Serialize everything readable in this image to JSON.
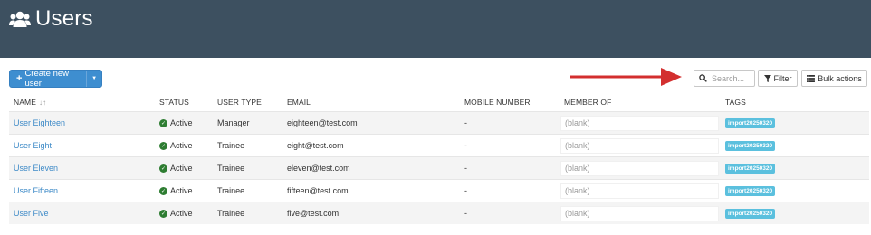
{
  "header": {
    "title": "Users",
    "icon": "users-icon"
  },
  "toolbar": {
    "create_label": "Create new user",
    "search_placeholder": "Search...",
    "filter_label": "Filter",
    "bulk_label": "Bulk actions"
  },
  "columns": {
    "name": "NAME",
    "status": "STATUS",
    "user_type": "USER TYPE",
    "email": "EMAIL",
    "mobile": "MOBILE NUMBER",
    "member_of": "MEMBER OF",
    "tags": "TAGS"
  },
  "rows": [
    {
      "name": "User Eighteen",
      "status": "Active",
      "type": "Manager",
      "email": "eighteen@test.com",
      "mobile": "-",
      "member": "(blank)",
      "tag": "import20250320"
    },
    {
      "name": "User Eight",
      "status": "Active",
      "type": "Trainee",
      "email": "eight@test.com",
      "mobile": "-",
      "member": "(blank)",
      "tag": "import20250320"
    },
    {
      "name": "User Eleven",
      "status": "Active",
      "type": "Trainee",
      "email": "eleven@test.com",
      "mobile": "-",
      "member": "(blank)",
      "tag": "import20250320"
    },
    {
      "name": "User Fifteen",
      "status": "Active",
      "type": "Trainee",
      "email": "fifteen@test.com",
      "mobile": "-",
      "member": "(blank)",
      "tag": "import20250320"
    },
    {
      "name": "User Five",
      "status": "Active",
      "type": "Trainee",
      "email": "five@test.com",
      "mobile": "-",
      "member": "(blank)",
      "tag": "import20250320"
    }
  ],
  "colors": {
    "header_bg": "#3d5060",
    "primary": "#3e8ed0",
    "link": "#3d8ac7",
    "tag": "#5bc0de",
    "active": "#2e7d32",
    "arrow": "#d32f2f"
  }
}
